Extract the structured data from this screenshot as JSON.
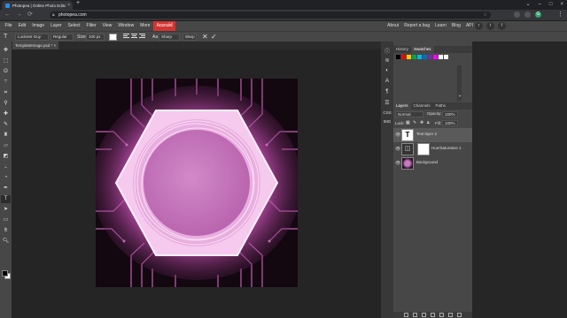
{
  "browser": {
    "tab_title": "Photopea | Online Photo Editor",
    "tab_close": "×",
    "new_tab": "+",
    "url": "photopea.com",
    "window_controls": [
      "⌄",
      "–",
      "□",
      "×"
    ]
  },
  "menubar": {
    "items": [
      "File",
      "Edit",
      "Image",
      "Layer",
      "Select",
      "Filter",
      "View",
      "Window",
      "More",
      "Account"
    ],
    "active_item": "Account",
    "right_links": [
      "About",
      "Report a bug",
      "Learn",
      "Blog",
      "API"
    ]
  },
  "options": {
    "font_family": "Luckiest Guy",
    "font_style": "Regular",
    "size_label": "Size:",
    "size_value": "100 px",
    "aa_label": "Aa",
    "aa_value": "Sharp",
    "warp_label": "Warp",
    "cancel_icon": "✕",
    "commit_icon": "✓"
  },
  "document": {
    "tab_label": "TemplateImage.psd *",
    "tab_close": "×"
  },
  "side_column": {
    "labels": [
      "CSS",
      "IMG"
    ]
  },
  "history_panel": {
    "tabs": [
      "History",
      "Swatches"
    ],
    "active_tab": "Swatches",
    "swatch_colors": [
      "#000000",
      "#ff0000",
      "#ffcc00",
      "#00a650",
      "#00b7eb",
      "#0070c0",
      "#7030a0",
      "#ff00ff",
      "#ffffff",
      "#ffffff"
    ]
  },
  "layers_panel": {
    "tabs": [
      "Layers",
      "Channels",
      "Paths"
    ],
    "active_tab": "Layers",
    "blend_mode": "Normal",
    "opacity_label": "Opacity:",
    "opacity_value": "100%",
    "lock_label": "Lock:",
    "fill_label": "Fill:",
    "fill_value": "100%",
    "layers": [
      {
        "name": "Text layer 2",
        "selected": true
      },
      {
        "name": "Hue/Saturation 1",
        "selected": false
      },
      {
        "name": "Background",
        "selected": false
      }
    ]
  },
  "colors": {
    "accent_active_menu": "#d43431",
    "canvas_glow": "#ea6bd6",
    "hexagon_fill": "#f6c9ef",
    "circle_fill": "#c87ac0"
  }
}
